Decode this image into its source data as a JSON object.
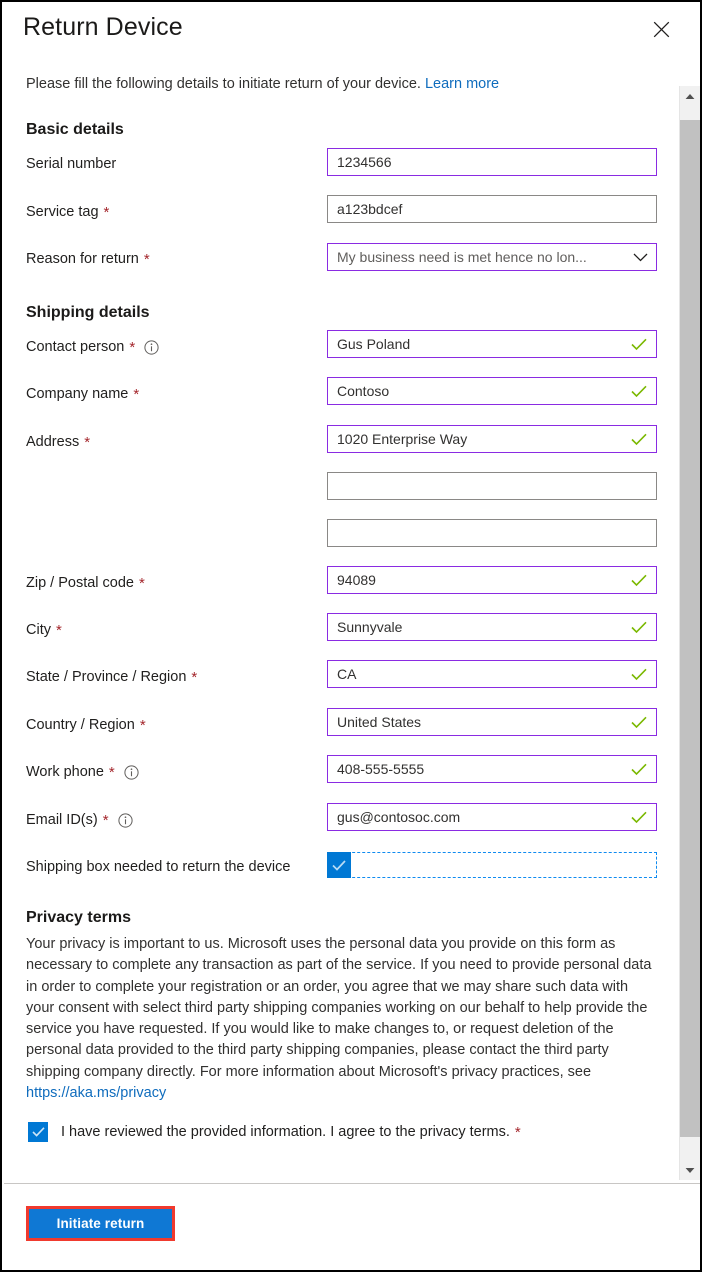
{
  "panel": {
    "title": "Return Device",
    "close_icon": "close-icon",
    "intro_text": "Please fill the following details to initiate return of your device.",
    "intro_link": "Learn more"
  },
  "sections": {
    "basic": {
      "title": "Basic details",
      "fields": [
        {
          "label": "Serial number",
          "required": false,
          "info": false,
          "value": "1234566",
          "state": "filled",
          "type": "text"
        },
        {
          "label": "Service tag",
          "required": true,
          "info": false,
          "value": "a123bdcef",
          "state": "neutral",
          "type": "text"
        },
        {
          "label": "Reason for return",
          "required": true,
          "info": false,
          "value": "My business need is met hence no lon...",
          "state": "dropdown",
          "type": "select"
        }
      ]
    },
    "shipping": {
      "title": "Shipping details",
      "fields": [
        {
          "label": "Contact person",
          "required": true,
          "info": true,
          "value": "Gus Poland",
          "state": "valid",
          "type": "text"
        },
        {
          "label": "Company name",
          "required": true,
          "info": false,
          "value": "Contoso",
          "state": "valid",
          "type": "text"
        },
        {
          "label": "Address",
          "required": true,
          "info": false,
          "value": "1020 Enterprise Way",
          "state": "valid",
          "type": "text"
        },
        {
          "label": "",
          "required": false,
          "info": false,
          "value": "",
          "state": "neutral",
          "type": "text"
        },
        {
          "label": "",
          "required": false,
          "info": false,
          "value": "",
          "state": "neutral",
          "type": "text"
        },
        {
          "label": "Zip / Postal code",
          "required": true,
          "info": false,
          "value": "94089",
          "state": "valid",
          "type": "text"
        },
        {
          "label": "City",
          "required": true,
          "info": false,
          "value": "Sunnyvale",
          "state": "valid",
          "type": "text"
        },
        {
          "label": "State / Province / Region",
          "required": true,
          "info": false,
          "value": "CA",
          "state": "valid",
          "type": "text"
        },
        {
          "label": "Country / Region",
          "required": true,
          "info": false,
          "value": "United States",
          "state": "valid",
          "type": "text"
        },
        {
          "label": "Work phone",
          "required": true,
          "info": true,
          "value": "408-555-5555",
          "state": "valid",
          "type": "text"
        },
        {
          "label": "Email ID(s)",
          "required": true,
          "info": true,
          "value": "gus@contosoc.com",
          "state": "valid",
          "type": "text"
        }
      ],
      "shipping_box": {
        "label": "Shipping box needed to return the device",
        "checked": true
      }
    },
    "privacy": {
      "title": "Privacy terms",
      "body": "Your privacy is important to us. Microsoft uses the personal data you provide on this form as necessary to complete any transaction as part of the service. If you need to provide personal data in order to complete your registration or an order, you agree that we may share such data with your consent with select third party shipping companies working on our behalf to help provide the service you have requested. If you would like to make changes to, or request deletion of the personal data provided to the third party shipping companies, please contact the third party shipping company directly. For more information about Microsoft's privacy practices, see ",
      "link": "https://aka.ms/privacy",
      "consent_label": "I have reviewed the provided information. I agree to the privacy terms.",
      "consent_checked": true,
      "consent_required": true
    }
  },
  "footer": {
    "submit_label": "Initiate return"
  },
  "scrollbar": {
    "up_icon": "chevron-up-icon",
    "down_icon": "chevron-down-icon"
  },
  "colors": {
    "accent_blue": "#0f78d4",
    "link_blue": "#0f6cbd",
    "required_red": "#a4262c",
    "annotation_red": "#f03a2e",
    "field_purple": "#8a2be2",
    "valid_green": "#7ab800",
    "checkbox_blue": "#0078d4"
  }
}
